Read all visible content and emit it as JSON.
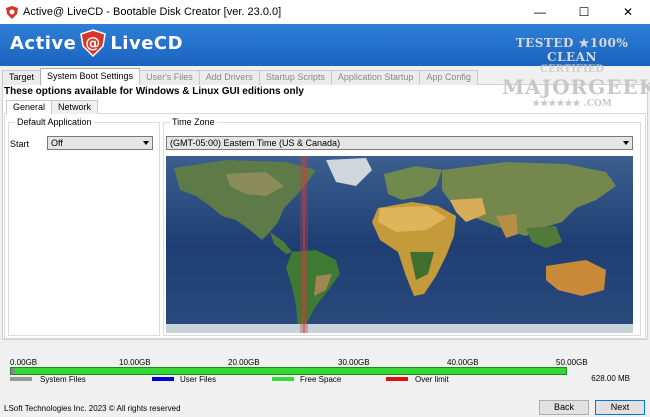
{
  "window": {
    "title": "Active@ LiveCD - Bootable Disk Creator [ver. 23.0.0]",
    "minimize": "—",
    "maximize": "☐",
    "close": "✕"
  },
  "banner": {
    "logo_left": "Active",
    "logo_right": "LiveCD",
    "colors": {
      "blue": "#1f6fcc",
      "logo_red": "#d8352a"
    }
  },
  "watermark": {
    "line1": "TESTED ★100% CLEAN",
    "line2": "CERTIFIED",
    "line3": "MAJORGEEKS",
    "line4": "★★★★★★ .COM"
  },
  "tabs": [
    {
      "label": "Target"
    },
    {
      "label": "System Boot Settings"
    },
    {
      "label": "User's Files"
    },
    {
      "label": "Add Drivers"
    },
    {
      "label": "Startup Scripts"
    },
    {
      "label": "Application Startup"
    },
    {
      "label": "App Config"
    }
  ],
  "note": "These options available for Windows & Linux GUI editions only",
  "subtabs": [
    {
      "label": "General"
    },
    {
      "label": "Network"
    }
  ],
  "default_application": {
    "group_title": "Default Application",
    "start_label": "Start",
    "start_value": "Off"
  },
  "time_zone": {
    "group_title": "Time Zone",
    "value": "(GMT-05:00) Eastern Time (US & Canada)"
  },
  "disk": {
    "scale": [
      "0.00GB",
      "10.00GB",
      "20.00GB",
      "30.00GB",
      "40.00GB",
      "50.00GB"
    ],
    "legend": [
      {
        "label": "System Files",
        "color": "#999999"
      },
      {
        "label": "User Files",
        "color": "#0000cc"
      },
      {
        "label": "Free Space",
        "color": "#33dd33"
      },
      {
        "label": "Over limit",
        "color": "#dd1111"
      }
    ],
    "total": "628.00 MB"
  },
  "footer": {
    "copyright": "LSoft Technologies Inc. 2023 © All rights reserved",
    "back": "Back",
    "next": "Next"
  }
}
